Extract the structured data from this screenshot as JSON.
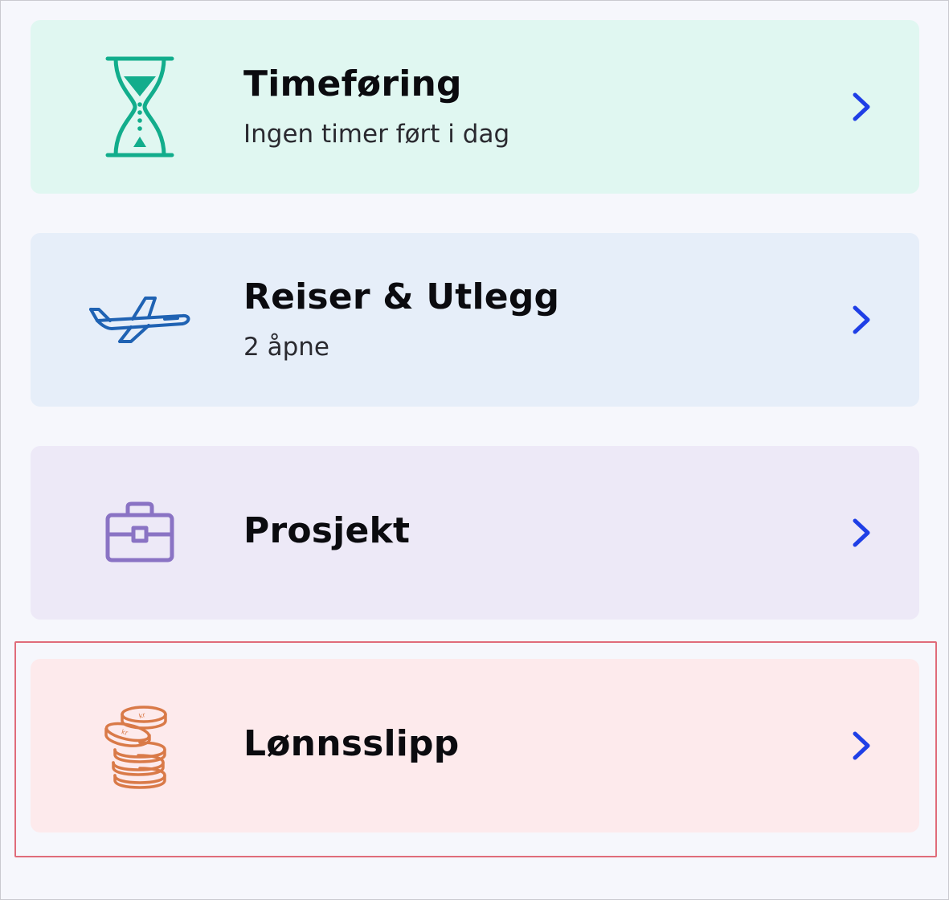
{
  "colors": {
    "page_bg": "#f6f7fc",
    "chevron": "#1f3fe6",
    "highlight": "#e06c7a"
  },
  "menu": {
    "items": [
      {
        "title": "Timeføring",
        "subtitle": "Ingen timer ført i dag",
        "icon": "hourglass-icon",
        "bg": "#e0f7f1",
        "icon_color": "#12ad8c"
      },
      {
        "title": "Reiser & Utlegg",
        "subtitle": "2 åpne",
        "icon": "airplane-icon",
        "bg": "#e6eef9",
        "icon_color": "#1f62b3"
      },
      {
        "title": "Prosjekt",
        "subtitle": "",
        "icon": "briefcase-icon",
        "bg": "#ede9f7",
        "icon_color": "#8a73c4"
      },
      {
        "title": "Lønnsslipp",
        "subtitle": "",
        "icon": "coins-icon",
        "bg": "#fdeaec",
        "icon_color": "#d97a48"
      }
    ]
  }
}
